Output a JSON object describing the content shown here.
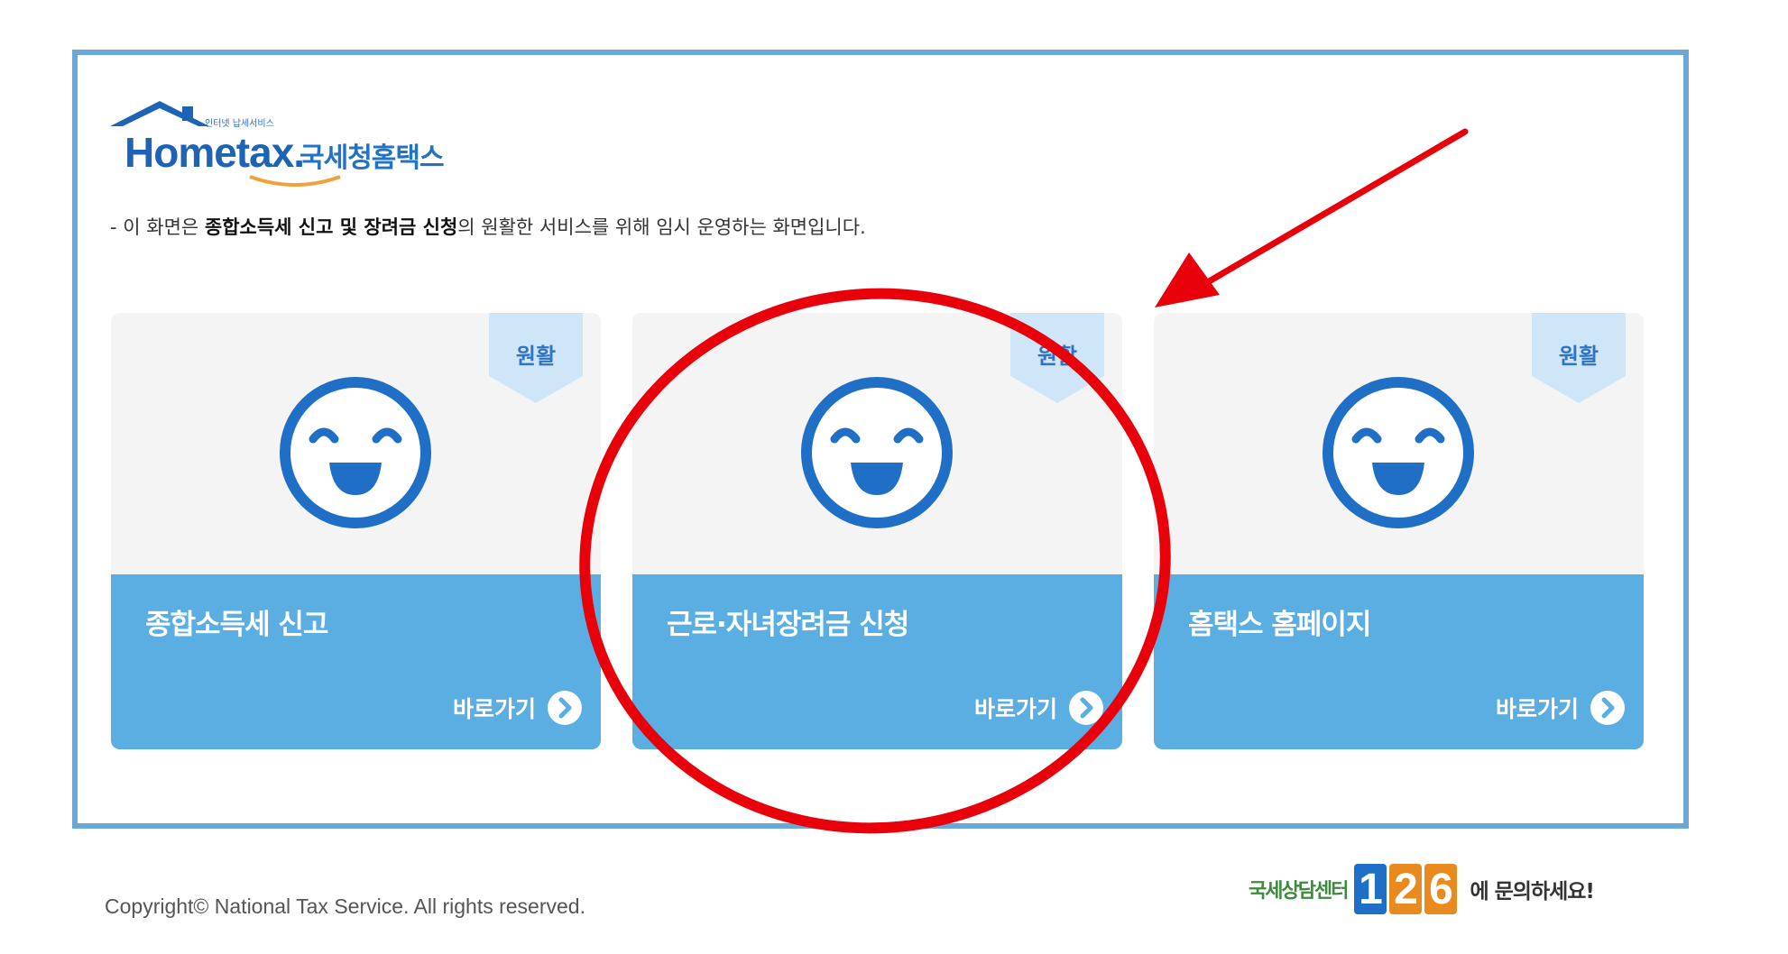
{
  "logo": {
    "subtitle": "인터넷 납세서비스",
    "wordmark": "Hometax.",
    "korean_name": "국세청홈택스"
  },
  "notice": {
    "prefix": "- 이 화면은 ",
    "bold": "종합소득세 신고 및 장려금 신청",
    "suffix": "의 원활한 서비스를 위해 임시 운영하는 화면입니다."
  },
  "cards": [
    {
      "status": "원활",
      "title": "종합소득세 신고",
      "link_label": "바로가기"
    },
    {
      "status": "원활",
      "title": "근로·자녀장려금 신청",
      "link_label": "바로가기"
    },
    {
      "status": "원활",
      "title": "홈택스 홈페이지",
      "link_label": "바로가기"
    }
  ],
  "footer": {
    "copyright": "Copyright© National Tax Service. All rights reserved.",
    "callcenter_label": "국세상담센터",
    "callcenter_number": [
      "1",
      "2",
      "6"
    ],
    "callcenter_suffix": "에 문의하세요!"
  },
  "colors": {
    "frame_border": "#6aa7d6",
    "card_bottom": "#5aaee2",
    "ribbon": "#cfe6f8",
    "face_blue": "#1f6fc6",
    "annotation_red": "#e8000b",
    "digit_colors": [
      "#1f6fc6",
      "#e98a1e",
      "#e98a1e"
    ]
  },
  "icons": {
    "face": "smiley-face-icon",
    "arrow": "chevron-right-circle-icon"
  }
}
